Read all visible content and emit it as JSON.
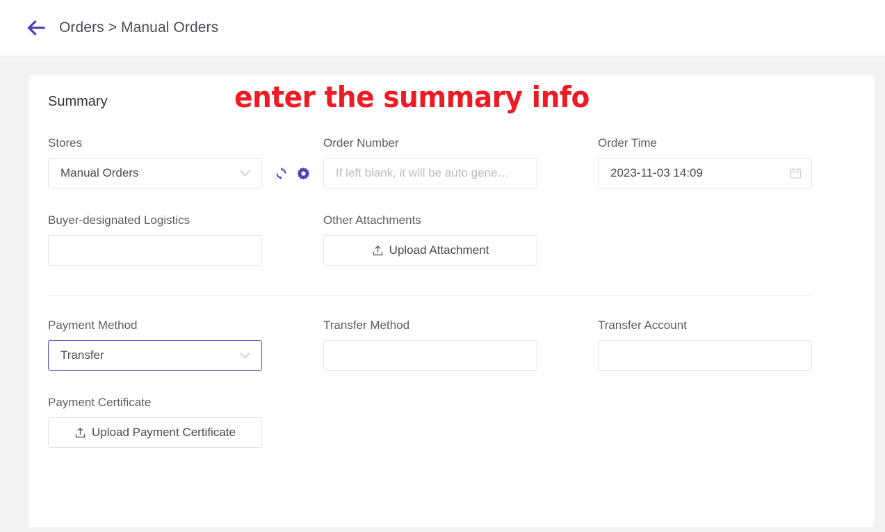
{
  "header": {
    "back_icon": "arrow-left-icon",
    "breadcrumb": "Orders > Manual Orders",
    "accent_color": "#4a3fb5"
  },
  "card": {
    "title": "Summary",
    "annotation": "enter the summary info",
    "annotation_color": "#ee1b24"
  },
  "form": {
    "stores": {
      "label": "Stores",
      "value": "Manual Orders",
      "chevron_icon": "chevron-down-icon",
      "refresh_icon": "refresh-icon",
      "settings_icon": "gear-icon"
    },
    "order_number": {
      "label": "Order Number",
      "value": "",
      "placeholder": "If left blank, it will be auto gene…"
    },
    "order_time": {
      "label": "Order Time",
      "value": "2023-11-03 14:09",
      "calendar_icon": "calendar-icon"
    },
    "buyer_logistics": {
      "label": "Buyer-designated Logistics",
      "value": "",
      "placeholder": ""
    },
    "other_attachments": {
      "label": "Other Attachments",
      "button_label": "Upload Attachment",
      "upload_icon": "upload-icon"
    },
    "payment_method": {
      "label": "Payment Method",
      "value": "Transfer",
      "chevron_icon": "chevron-down-icon",
      "focus_color": "#5b4bc4"
    },
    "transfer_method": {
      "label": "Transfer Method",
      "value": "",
      "placeholder": ""
    },
    "transfer_account": {
      "label": "Transfer Account",
      "value": "",
      "placeholder": ""
    },
    "payment_certificate": {
      "label": "Payment Certificate",
      "button_label": "Upload Payment Certificate",
      "upload_icon": "upload-icon"
    }
  }
}
